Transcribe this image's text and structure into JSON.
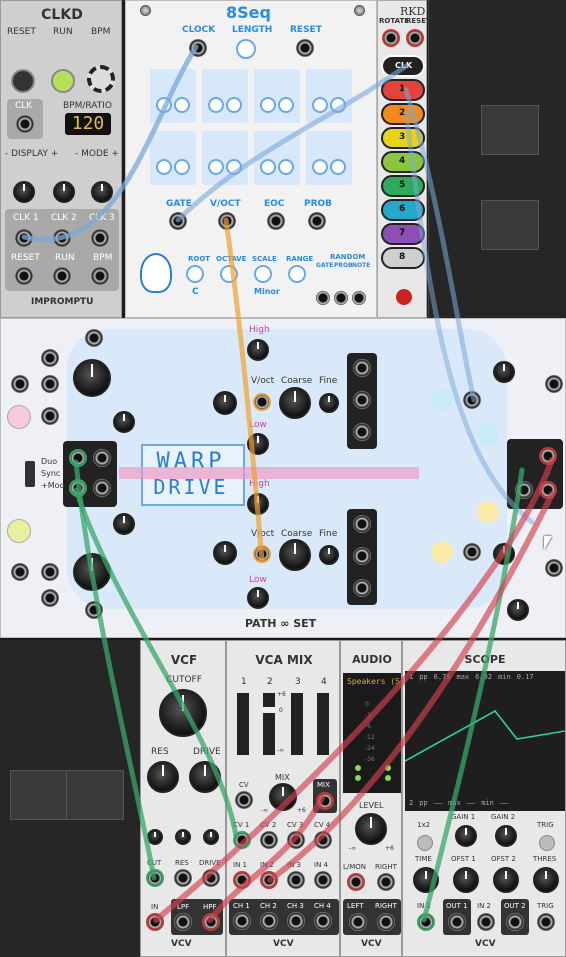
{
  "clkd": {
    "title": "CLKD",
    "top_labels": [
      "RESET",
      "RUN",
      "BPM"
    ],
    "clk_label": "CLK",
    "bpm_ratio_label": "BPM/RATIO",
    "display_value": "120",
    "display_label": "- DISPLAY +",
    "mode_label": "- MODE +",
    "clk_out_labels": [
      "CLK 1",
      "CLK 2",
      "CLK 3"
    ],
    "bottom_labels": [
      "RESET",
      "RUN",
      "BPM"
    ],
    "brand": "IMPROMPTU"
  },
  "seq": {
    "title": "8Seq",
    "top_labels": [
      "CLOCK",
      "LENGTH",
      "RESET"
    ],
    "out_labels": [
      "GATE",
      "V/OCT",
      "EOC",
      "PROB"
    ],
    "root_label": "ROOT",
    "root_value": "C",
    "octave_label": "OCTAVE",
    "scale_label": "SCALE",
    "scale_value": "Minor",
    "range_label": "RANGE",
    "random_label": "RANDOM",
    "random_sub": [
      "GATE",
      "PROB",
      "NOTE"
    ]
  },
  "rkd": {
    "title": "RKD",
    "top_labels": [
      "ROTATE",
      "RESET"
    ],
    "clk_label": "CLK",
    "channels": [
      "1",
      "2",
      "3",
      "4",
      "5",
      "6",
      "7",
      "8"
    ],
    "colors": [
      "#e0453c",
      "#f08a1d",
      "#e8d21a",
      "#8bc53f",
      "#2faa5a",
      "#27a7c7",
      "#8e4fb5",
      "#cfcfcf"
    ]
  },
  "warp": {
    "title_line1": "WARP",
    "title_line2": "DRIVE",
    "high_label": "High",
    "low_label": "Low",
    "voct_label": "V/oct",
    "coarse_label": "Coarse",
    "fine_label": "Fine",
    "mode_labels": [
      "Duo",
      "Sync",
      "+Mod"
    ],
    "footer": "PATH ∞ SET"
  },
  "vcf": {
    "title": "VCF",
    "cutoff": "CUTOFF",
    "res": "RES",
    "drive": "DRIVE",
    "jack_labels": [
      "CUT",
      "RES",
      "DRIVE"
    ],
    "in": "IN",
    "lpf": "LPF",
    "hpf": "HPF",
    "brand": "VCV"
  },
  "vcamix": {
    "title": "VCA MIX",
    "channel_numbers": [
      "1",
      "2",
      "3",
      "4"
    ],
    "fader_scale": [
      "+6",
      "0",
      "-∞"
    ],
    "cv_label": "CV",
    "mix_label": "MIX",
    "mix_range": [
      "-∞",
      "+6"
    ],
    "mix_out": "MIX",
    "cv_labels": [
      "CV 1",
      "CV 2",
      "CV 3",
      "CV 4"
    ],
    "in_labels": [
      "IN 1",
      "IN 2",
      "IN 3",
      "IN 4"
    ],
    "ch_labels": [
      "CH 1",
      "CH 2",
      "CH 3",
      "CH 4"
    ],
    "brand": "VCV"
  },
  "audio": {
    "title": "AUDIO",
    "device": "Speakers (S",
    "meter_ticks": [
      "0",
      "-3",
      "-6",
      "-12",
      "-24",
      "-36"
    ],
    "level_label": "LEVEL",
    "level_range": [
      "-∞",
      "+6"
    ],
    "in_labels": [
      "L/MON",
      "RIGHT"
    ],
    "out_labels": [
      "LEFT",
      "RIGHT"
    ],
    "brand": "VCV"
  },
  "scope": {
    "title": "SCOPE",
    "readout_top": [
      "1",
      "pp",
      "6.75",
      "max",
      "6.92",
      "min",
      "0.17"
    ],
    "readout_bottom": [
      "2",
      "pp",
      "——",
      "max",
      "——",
      "min",
      "——"
    ],
    "button_labels": [
      "1x2",
      "GAIN 1",
      "GAIN 2",
      "TRIG"
    ],
    "knob_labels": [
      "TIME",
      "OFST 1",
      "OFST 2",
      "THRES"
    ],
    "jack_labels": [
      "IN 1",
      "OUT 1",
      "IN 2",
      "OUT 2",
      "TRIG"
    ],
    "brand": "VCV"
  }
}
